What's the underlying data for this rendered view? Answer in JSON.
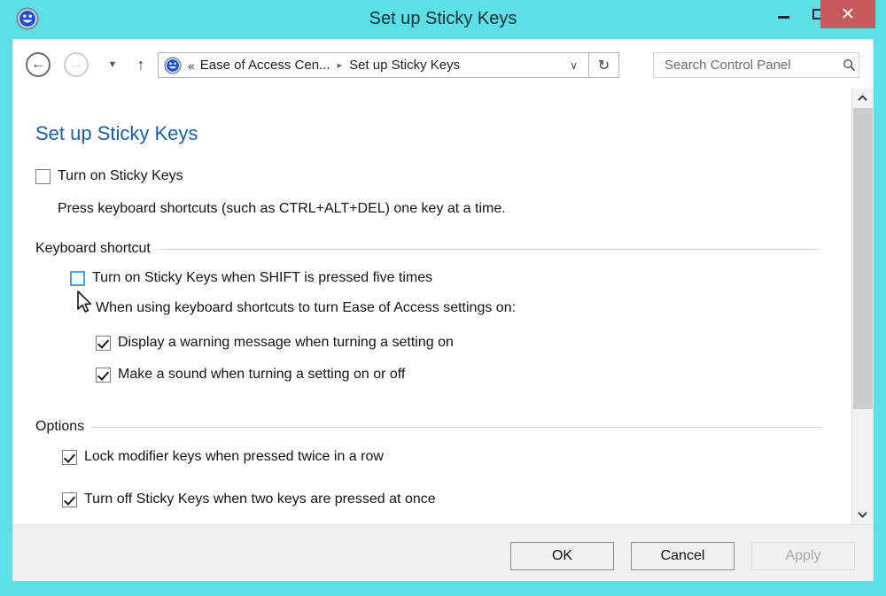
{
  "window": {
    "title": "Set up Sticky Keys",
    "app_icon": "ease-of-access-icon",
    "titlebar_color": "#5ce0e8",
    "close_button_color": "#c75b5b",
    "controls": {
      "minimize_label": "Minimize",
      "maximize_label": "Maximize",
      "close_label": "Close",
      "close_glyph": "✕"
    }
  },
  "toolbar": {
    "back_label": "Back",
    "back_glyph": "←",
    "forward_label": "Forward",
    "forward_glyph": "→",
    "recent_pages_label": "Recent pages",
    "recent_glyph": "▼",
    "up_label": "Up one level",
    "up_glyph": "↑",
    "address": {
      "icon": "ease-of-access-icon",
      "overflow_glyph": "«",
      "crumb_1": "Ease of Access Cen...",
      "crumb_separator": "▸",
      "crumb_2": "Set up Sticky Keys",
      "dropdown_glyph": "∨"
    },
    "refresh_label": "Refresh",
    "refresh_glyph": "↻",
    "search": {
      "placeholder": "Search Control Panel",
      "value": "",
      "icon_glyph": "⌕"
    }
  },
  "page": {
    "heading": "Set up Sticky Keys",
    "heading_color": "#1b5fa8",
    "main_checkbox": {
      "label": "Turn on Sticky Keys",
      "checked": false
    },
    "main_description": "Press keyboard shortcuts (such as CTRL+ALT+DEL) one key at a time.",
    "groups": [
      {
        "title": "Keyboard shortcut",
        "items": [
          {
            "label": "Turn on Sticky Keys when SHIFT is pressed five times",
            "checked": false,
            "hover": true
          },
          {
            "label": "Display a warning message when turning a setting on",
            "checked": true,
            "hover": false
          },
          {
            "label": "Make a sound when turning a setting on or off",
            "checked": true,
            "hover": false
          }
        ],
        "sub_label": "When using keyboard shortcuts to turn Ease of Access settings on:"
      },
      {
        "title": "Options",
        "items": [
          {
            "label": "Lock modifier keys when pressed twice in a row",
            "checked": true,
            "hover": false
          },
          {
            "label": "Turn off Sticky Keys when two keys are pressed at once",
            "checked": true,
            "hover": false
          }
        ]
      }
    ]
  },
  "scrollbar": {
    "up_glyph": "⌃",
    "down_glyph": "⌄"
  },
  "footer": {
    "ok_label": "OK",
    "cancel_label": "Cancel",
    "apply_label": "Apply",
    "apply_enabled": false
  }
}
